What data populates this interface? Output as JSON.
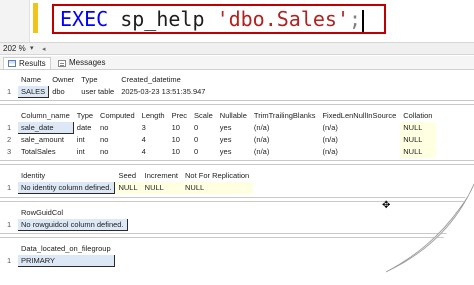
{
  "query": {
    "keyword": "EXEC",
    "proc": "sp_help",
    "argument": "'dbo.Sales'",
    "terminator": ";"
  },
  "zoom": {
    "value": "202 %",
    "dropdown": "▾",
    "scroll_left": "◂"
  },
  "tabs": [
    {
      "label": "Results"
    },
    {
      "label": "Messages"
    }
  ],
  "grid1": {
    "headers": [
      "Name",
      "Owner",
      "Type",
      "Created_datetime"
    ],
    "rows": [
      {
        "num": "1",
        "cells": [
          "SALES",
          "dbo",
          "user table",
          "2025-03-23 13:51:35.947"
        ]
      }
    ]
  },
  "grid2": {
    "headers": [
      "Column_name",
      "Type",
      "Computed",
      "Length",
      "Prec",
      "Scale",
      "Nullable",
      "TrimTrailingBlanks",
      "FixedLenNullInSource",
      "Collation"
    ],
    "rows": [
      {
        "num": "1",
        "cells": [
          "sale_date",
          "date",
          "no",
          "3",
          "10",
          "0",
          "yes",
          "(n/a)",
          "(n/a)",
          "NULL"
        ]
      },
      {
        "num": "2",
        "cells": [
          "sale_amount",
          "int",
          "no",
          "4",
          "10",
          "0",
          "yes",
          "(n/a)",
          "(n/a)",
          "NULL"
        ]
      },
      {
        "num": "3",
        "cells": [
          "TotalSales",
          "int",
          "no",
          "4",
          "10",
          "0",
          "yes",
          "(n/a)",
          "(n/a)",
          "NULL"
        ]
      }
    ]
  },
  "grid3": {
    "headers": [
      "Identity",
      "Seed",
      "Increment",
      "Not For Replication"
    ],
    "rows": [
      {
        "num": "1",
        "cells": [
          "No identity column defined.",
          "NULL",
          "NULL",
          "NULL"
        ]
      }
    ]
  },
  "grid4": {
    "headers": [
      "RowGuidCol"
    ],
    "rows": [
      {
        "num": "1",
        "cells": [
          "No rowguidcol column defined."
        ]
      }
    ]
  },
  "grid5": {
    "headers": [
      "Data_located_on_filegroup"
    ],
    "rows": [
      {
        "num": "1",
        "cells": [
          "PRIMARY"
        ]
      }
    ]
  },
  "colors": {
    "highlight_border": "#c00000",
    "keyword": "#0000ff",
    "string": "#b22222",
    "change_bar": "#f0c419",
    "null_cell": "#ffffe1"
  }
}
